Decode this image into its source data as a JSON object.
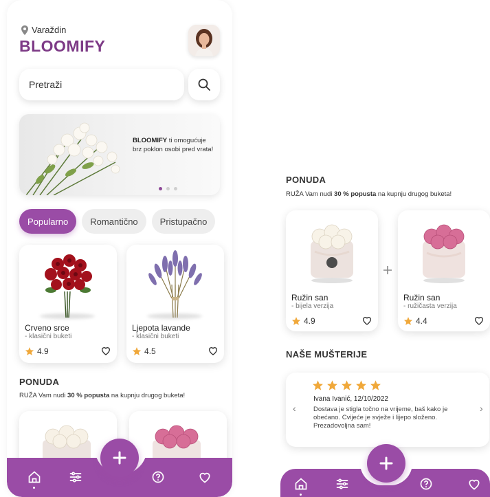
{
  "header": {
    "location": "Varaždin",
    "logo": "BLOOMIFY"
  },
  "search": {
    "placeholder": "Pretraži"
  },
  "banner": {
    "brand": "BLOOMIFY",
    "text": " ti omogućuje brz poklon osobi pred vrata!"
  },
  "categories": [
    "Popularno",
    "Romantično",
    "Pristupačno"
  ],
  "products": [
    {
      "name": "Crveno srce",
      "sub": "- klasični buketi",
      "rating": "4.9"
    },
    {
      "name": "Ljepota lavande",
      "sub": "- klasični buketi",
      "rating": "4.5"
    }
  ],
  "offer": {
    "title": "PONUDA",
    "text_before": "RUŽA Vam nudi ",
    "text_bold": "30 % popusta",
    "text_after": " na kupnju drugog buketa!"
  },
  "offer_products": [
    {
      "name": "Ružin san",
      "sub": "- bijela verzija",
      "rating": "4.9"
    },
    {
      "name": "Ružin san",
      "sub": "- ružičasta verzija",
      "rating": "4.4"
    }
  ],
  "customers": {
    "title": "NAŠE MUŠTERIJE",
    "author": "Ivana Ivanić, 12/10/2022",
    "text": "Dostava je stigla točno na vrijeme, baš kako je obećano. Cvijeće je svježe i lijepo složeno. Prezadovoljna sam!",
    "stars": 5
  },
  "colors": {
    "brand": "#9a4ca6",
    "logo": "#7d3a86",
    "star": "#f0a83a"
  },
  "icons": {
    "nav": [
      "home-icon",
      "filter-icon",
      "help-icon",
      "heart-icon"
    ],
    "fab": "plus-icon"
  }
}
